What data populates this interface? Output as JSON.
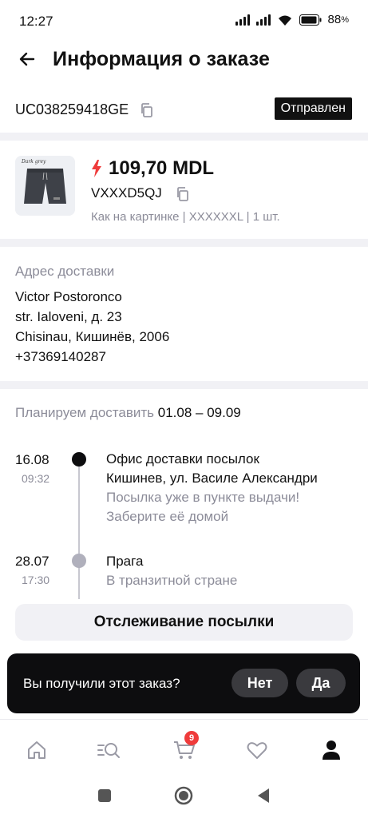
{
  "status_bar": {
    "time": "12:27",
    "battery": "88"
  },
  "header": {
    "title": "Информация о заказе"
  },
  "order": {
    "tracking_number": "UC038259418GE",
    "status": "Отправлен"
  },
  "product": {
    "price": "109,70 MDL",
    "code": "VXXXD5QJ",
    "meta": "Как на картинке | XXXXXXL | 1 шт.",
    "image_caption": "Dark grey"
  },
  "address": {
    "label": "Адрес доставки",
    "name": "Victor Postoronco",
    "street": "str. Ialoveni, д. 23",
    "city": "Chisinau, Кишинёв, 2006",
    "phone": "+37369140287"
  },
  "planned": {
    "label": "Планируем доставить",
    "dates": "01.08 – 09.09"
  },
  "timeline": [
    {
      "date": "16.08",
      "time": "09:32",
      "title_1": "Офис доставки посылок",
      "title_2": "Кишинев, ул. Василе Александри",
      "sub_1": "Посылка уже в пункте выдачи!",
      "sub_2": "Заберите её домой"
    },
    {
      "date": "28.07",
      "time": "17:30",
      "title_1": "Прага",
      "sub_1": "В транзитной стране"
    }
  ],
  "track_button": "Отслеживание посылки",
  "toast": {
    "question": "Вы получили этот заказ?",
    "no": "Нет",
    "yes": "Да"
  },
  "nav": {
    "cart_count": "9"
  },
  "colors": {
    "accent": "#ef3b3b",
    "muted": "#8c8c99",
    "dark": "#0d0d0f"
  }
}
